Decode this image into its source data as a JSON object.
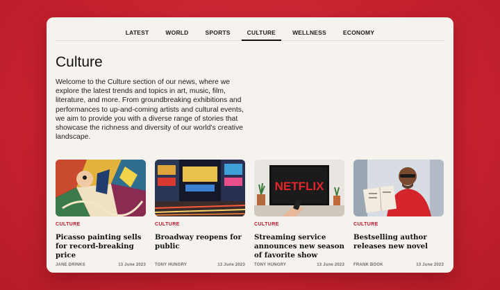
{
  "nav": {
    "tabs": [
      {
        "label": "LATEST"
      },
      {
        "label": "WORLD"
      },
      {
        "label": "SPORTS"
      },
      {
        "label": "CULTURE",
        "active": true
      },
      {
        "label": "WELLNESS"
      },
      {
        "label": "ECONOMY"
      }
    ]
  },
  "page": {
    "title": "Culture",
    "intro": "Welcome to the Culture section of our news, where we explore the latest trends and topics in art, music, film, literature, and more. From groundbreaking exhibitions and performances to up-and-coming artists and cultural events, we aim to provide you with a diverse range of stories that showcase the richness and diversity of our world's creative landscape."
  },
  "articles": [
    {
      "category": "CULTURE",
      "headline": "Picasso painting sells for record-breaking price",
      "author": "JANE DRINKS",
      "date": "13 June 2023",
      "image": "cubist-painting"
    },
    {
      "category": "CULTURE",
      "headline": "Broadway reopens for public",
      "author": "TONY HUNGRY",
      "date": "13 June 2023",
      "image": "times-square"
    },
    {
      "category": "CULTURE",
      "headline": "Streaming service announces new season of favorite show",
      "author": "TONY HUNGRY",
      "date": "13 June 2023",
      "image": "netflix-tv",
      "image_text": "NETFLIX"
    },
    {
      "category": "CULTURE",
      "headline": "Bestselling author releases new novel",
      "author": "FRANK BOOK",
      "date": "13 June 2023",
      "image": "man-reading-book"
    }
  ],
  "colors": {
    "accent": "#b6162a",
    "background": "#c8232f",
    "panel": "#f6f3ee"
  }
}
